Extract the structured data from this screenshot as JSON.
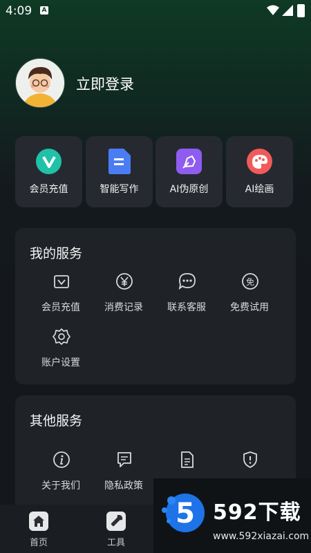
{
  "status_bar": {
    "time": "4:09",
    "notif_glyph": "A"
  },
  "profile": {
    "login_label": "立即登录"
  },
  "quick_actions": [
    {
      "label": "会员充值",
      "icon": "vip-v-icon",
      "color": "#1fc1a8"
    },
    {
      "label": "智能写作",
      "icon": "document-icon",
      "color": "#4a7df4"
    },
    {
      "label": "AI伪原创",
      "icon": "pen-nib-icon",
      "color": "#8e5cf0"
    },
    {
      "label": "AI绘画",
      "icon": "palette-icon",
      "color": "#f25a5a"
    }
  ],
  "my_services": {
    "title": "我的服务",
    "items": [
      {
        "label": "会员充值",
        "icon": "vip-card-icon"
      },
      {
        "label": "消费记录",
        "icon": "yen-coin-icon"
      },
      {
        "label": "联系客服",
        "icon": "chat-bubble-icon"
      },
      {
        "label": "免费试用",
        "icon": "free-badge-icon",
        "glyph": "免"
      },
      {
        "label": "账户设置",
        "icon": "gear-icon"
      }
    ]
  },
  "other_services": {
    "title": "其他服务",
    "items": [
      {
        "label": "关于我们",
        "icon": "info-icon"
      },
      {
        "label": "隐私政策",
        "icon": "message-square-icon"
      },
      {
        "label": "",
        "icon": "document-lines-icon"
      },
      {
        "label": "",
        "icon": "shield-alert-icon"
      }
    ]
  },
  "bottom_nav": [
    {
      "label": "首页",
      "icon": "home-icon"
    },
    {
      "label": "工具",
      "icon": "wrench-icon"
    }
  ],
  "watermark": {
    "title": "592下载",
    "url": "www.592xiazai.com",
    "logo_digit": "5"
  }
}
